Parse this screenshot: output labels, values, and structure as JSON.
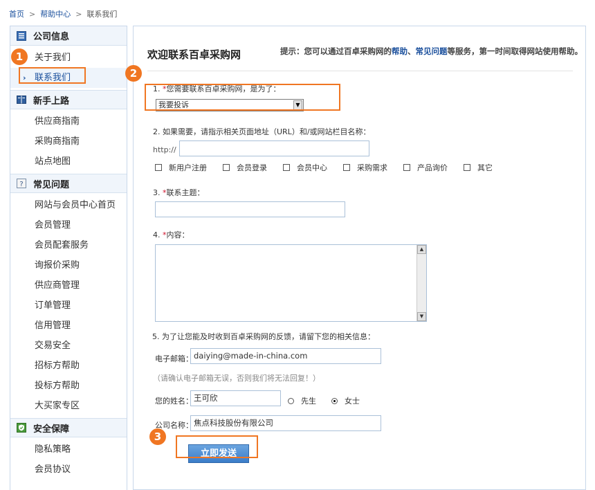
{
  "breadcrumb": {
    "home": "首页",
    "help": "帮助中心",
    "current": "联系我们",
    "separator": ">"
  },
  "sidebar": {
    "sections": [
      {
        "title": "公司信息",
        "icon": "company-info-icon",
        "items": [
          "关于我们",
          "联系我们"
        ]
      },
      {
        "title": "新手上路",
        "icon": "book-icon",
        "items": [
          "供应商指南",
          "采购商指南",
          "站点地图"
        ]
      },
      {
        "title": "常见问题",
        "icon": "question-icon",
        "items": [
          "网站与会员中心首页",
          "会员管理",
          "会员配套服务",
          "询报价采购",
          "供应商管理",
          "订单管理",
          "信用管理",
          "交易安全",
          "招标方帮助",
          "投标方帮助",
          "大买家专区"
        ]
      },
      {
        "title": "安全保障",
        "icon": "shield-icon",
        "items": [
          "隐私策略",
          "会员协议"
        ]
      }
    ],
    "active_arrow": "›"
  },
  "main": {
    "title": "欢迎联系百卓采购网",
    "hint_prefix": "提示：您可以通过百卓采购网的",
    "hint_link1": "帮助",
    "hint_sep": "、",
    "hint_link2": "常见问题",
    "hint_suffix": "等服务，第一时间取得网站使用帮助。"
  },
  "form": {
    "q1_num": "1.",
    "q1_label": "您需要联系百卓采购网，是为了：",
    "q1_selected": "我要投诉",
    "q2_label": "2. 如果需要，请指示相关页面地址（URL）和/或网站栏目名称：",
    "url_prefix": "http://",
    "url_value": "",
    "checkboxes": [
      "新用户注册",
      "会员登录",
      "会员中心",
      "采购需求",
      "产品询价",
      "其它"
    ],
    "q3_num": "3.",
    "q3_label": "联系主题：",
    "subject_value": "",
    "q4_num": "4.",
    "q4_label": "内容：",
    "q5_label": "5. 为了让您能及时收到百卓采购网的反馈，请留下您的相关信息：",
    "email_label": "电子邮箱：",
    "email_value": "daiying@made-in-china.com",
    "email_note": "（请确认电子邮箱无误，否则我们将无法回复！）",
    "name_label": "您的姓名：",
    "name_value": "王可欣",
    "gender_male": "先生",
    "gender_female": "女士",
    "gender_selected": "女士",
    "company_label": "公司名称：",
    "company_value": "焦点科技股份有限公司",
    "submit_label": "立即发送",
    "required_mark": "*"
  },
  "callouts": [
    "1",
    "2",
    "3"
  ],
  "colors": {
    "accent_orange": "#f07622",
    "link_blue": "#1a4f9c",
    "required_red": "#d0102a",
    "button_blue": "#3b7dc9"
  }
}
